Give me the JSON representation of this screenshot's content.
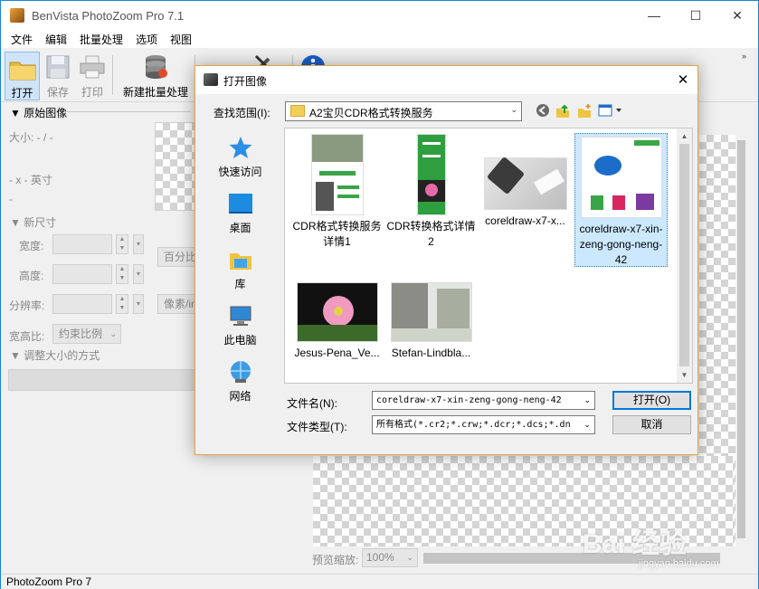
{
  "app": {
    "title": "BenVista PhotoZoom Pro 7.1",
    "window_controls": {
      "minimize": "—",
      "maximize": "☐",
      "close": "✕"
    },
    "menu": [
      "文件",
      "编辑",
      "批量处理",
      "选项",
      "视图"
    ],
    "toolbar": {
      "open": "打开",
      "save": "保存",
      "print": "打印",
      "batch": "新建批量处理"
    },
    "status": "PhotoZoom Pro 7"
  },
  "left_panel": {
    "original_header": "▼ 原始图像",
    "size_label": "大小: - / -",
    "dims_label": "- x - 英寸",
    "dash": "-",
    "new_size_header": "▼ 新尺寸",
    "width_label": "宽度:",
    "height_label": "高度:",
    "resolution_label": "分辨率:",
    "percent_unit": "百分比",
    "pixel_unit": "像素/in",
    "aspect_label": "宽高比:",
    "aspect_value": "约束比例",
    "resize_header": "▼ 调整大小的方式"
  },
  "preview": {
    "zoom_label": "预览缩放:",
    "zoom_value": "100%"
  },
  "dialog": {
    "title": "打开图像",
    "close": "✕",
    "look_in_label": "查找范围(I):",
    "look_in_value": "A2宝贝CDR格式转换服务",
    "places": [
      {
        "label": "快速访问",
        "icon": "star-icon"
      },
      {
        "label": "桌面",
        "icon": "desktop-icon"
      },
      {
        "label": "库",
        "icon": "library-icon"
      },
      {
        "label": "此电脑",
        "icon": "computer-icon"
      },
      {
        "label": "网络",
        "icon": "network-icon"
      }
    ],
    "files": [
      {
        "name": "CDR格式转换服务详情1"
      },
      {
        "name": "CDR转换格式详情2"
      },
      {
        "name": "coreldraw-x7-x..."
      },
      {
        "name": "coreldraw-x7-xin-zeng-gong-neng-42"
      },
      {
        "name": "Jesus-Pena_Ve..."
      },
      {
        "name": "Stefan-Lindbla..."
      }
    ],
    "filename_label": "文件名(N):",
    "filename_value": "coreldraw-x7-xin-zeng-gong-neng-42",
    "filetype_label": "文件类型(T):",
    "filetype_value": "所有格式(*.cr2;*.crw;*.dcr;*.dcs;*.dn",
    "open_button": "打开(O)",
    "cancel_button": "取消"
  },
  "watermark": {
    "main": "Bai 经验",
    "sub": "jingyan.baidu.com"
  },
  "colors": {
    "accent": "#0078d7",
    "selection": "#cce8ff",
    "dialog_border": "#e4a33c"
  }
}
